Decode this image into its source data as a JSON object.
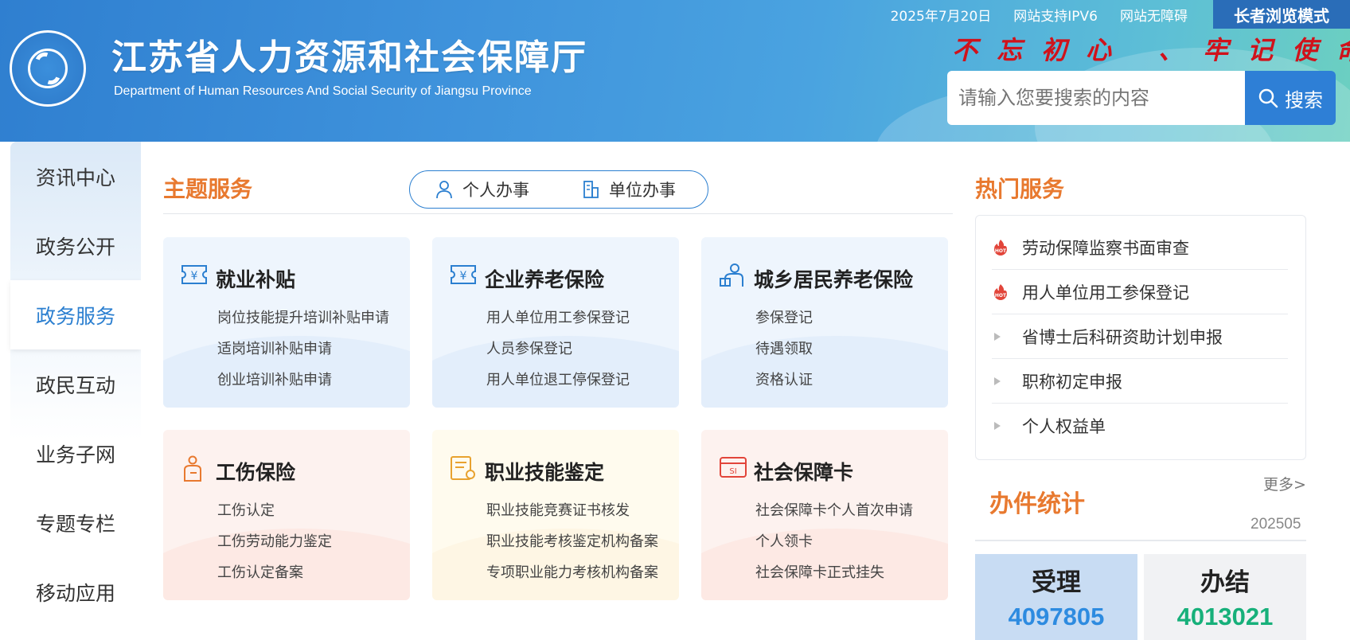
{
  "topbar": {
    "date": "2025年7月20日",
    "ipv6": "网站支持IPV6",
    "accessible": "网站无障碍",
    "elder_mode": "长者浏览模式"
  },
  "header": {
    "title": "江苏省人力资源和社会保障厅",
    "subtitle": "Department of Human Resources And Social Security of Jiangsu Province",
    "slogan": "不忘初心 、牢记使命"
  },
  "search": {
    "placeholder": "请输入您要搜索的内容",
    "button_label": "搜索"
  },
  "sidebar": {
    "items": [
      {
        "label": "资讯中心"
      },
      {
        "label": "政务公开"
      },
      {
        "label": "政务服务"
      },
      {
        "label": "政民互动"
      },
      {
        "label": "业务子网"
      },
      {
        "label": "专题专栏"
      },
      {
        "label": "移动应用"
      }
    ]
  },
  "main": {
    "section_title": "主题服务",
    "tabs": [
      {
        "label": "个人办事"
      },
      {
        "label": "单位办事"
      }
    ],
    "cards": [
      {
        "title": "就业补贴",
        "icon": "yuan-ticket-icon",
        "links": [
          "岗位技能提升培训补贴申请",
          "适岗培训补贴申请",
          "创业培训补贴申请"
        ]
      },
      {
        "title": "企业养老保险",
        "icon": "yuan-ticket-icon",
        "links": [
          "用人单位用工参保登记",
          "人员参保登记",
          "用人单位退工停保登记"
        ]
      },
      {
        "title": "城乡居民养老保险",
        "icon": "elder-icon",
        "links": [
          "参保登记",
          "待遇领取",
          "资格认证"
        ]
      },
      {
        "title": "工伤保险",
        "icon": "injury-icon",
        "links": [
          "工伤认定",
          "工伤劳动能力鉴定",
          "工伤认定备案"
        ]
      },
      {
        "title": "职业技能鉴定",
        "icon": "certificate-icon",
        "links": [
          "职业技能竞赛证书核发",
          "职业技能考核鉴定机构备案",
          "专项职业能力考核机构备案"
        ]
      },
      {
        "title": "社会保障卡",
        "icon": "card-icon",
        "links": [
          "社会保障卡个人首次申请",
          "个人领卡",
          "社会保障卡正式挂失"
        ]
      }
    ]
  },
  "hot": {
    "title": "热门服务",
    "items": [
      {
        "label": "劳动保障监察书面审查",
        "icon": "hot-icon"
      },
      {
        "label": "用人单位用工参保登记",
        "icon": "hot-icon"
      },
      {
        "label": "省博士后科研资助计划申报",
        "icon": "triangle-icon"
      },
      {
        "label": "职称初定申报",
        "icon": "triangle-icon"
      },
      {
        "label": "个人权益单",
        "icon": "triangle-icon"
      }
    ],
    "more": "更多>"
  },
  "stats": {
    "title": "办件统计",
    "period": "202505",
    "accepted_label": "受理",
    "accepted_value": "4097805",
    "completed_label": "办结",
    "completed_value": "4013021"
  },
  "colors": {
    "accent_orange": "#e8792f",
    "brand_blue": "#2b7fd0",
    "accepted_blue": "#2d8be0",
    "completed_green": "#17b07a",
    "slogan_red": "#d0121b"
  }
}
